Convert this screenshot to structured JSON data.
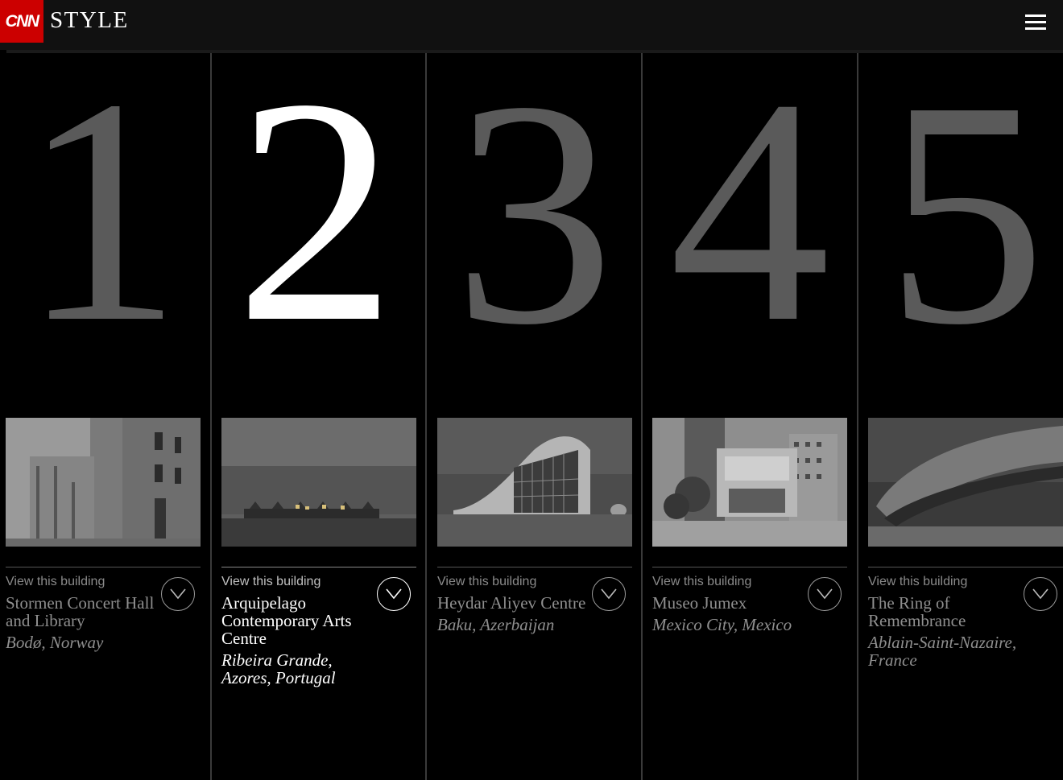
{
  "header": {
    "logo": "CNN",
    "section": "STYLE",
    "menu_icon": "hamburger-menu-icon"
  },
  "colors": {
    "brand_red": "#cc0000",
    "background": "#000000",
    "inactive_numeral": "#5a5a5a",
    "active_numeral": "#ffffff"
  },
  "cta_label": "View this building",
  "buildings": [
    {
      "number": "1",
      "name": "Stormen Concert Hall and Library",
      "place": "Bodø, Norway",
      "active": false
    },
    {
      "number": "2",
      "name": "Arquipelago Contemporary Arts Centre",
      "place": "Ribeira Grande, Azores, Portugal",
      "active": true
    },
    {
      "number": "3",
      "name": "Heydar Aliyev Centre",
      "place": "Baku, Azerbaijan",
      "active": false
    },
    {
      "number": "4",
      "name": "Museo Jumex",
      "place": "Mexico City, Mexico",
      "active": false
    },
    {
      "number": "5",
      "name": "The Ring of Remembrance",
      "place": "Ablain-Saint-Nazaire, France",
      "active": false
    }
  ]
}
